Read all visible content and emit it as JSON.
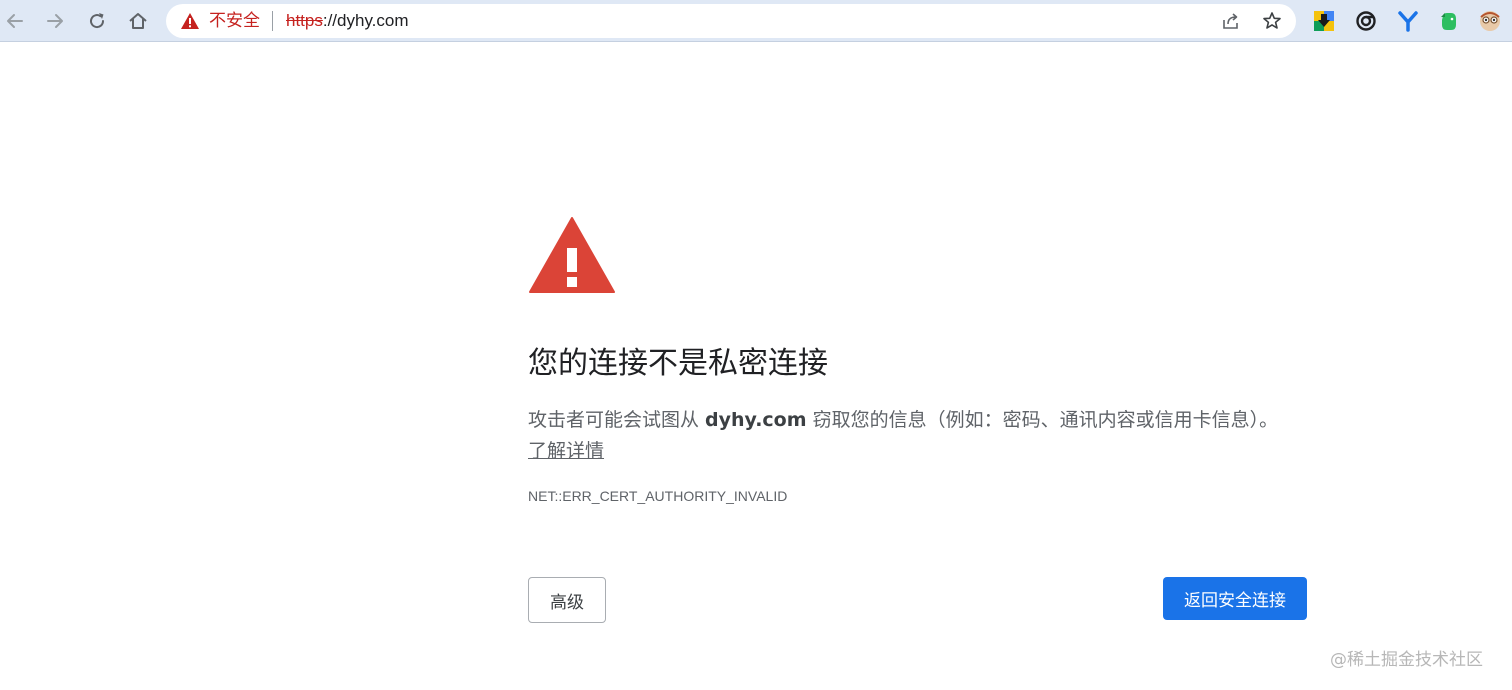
{
  "toolbar": {
    "security_label": "不安全",
    "url_scheme": "https",
    "url_rest": "://dyhy.com"
  },
  "icons": {
    "back": "back-arrow-icon",
    "forward": "forward-arrow-icon",
    "reload": "reload-icon",
    "home": "home-icon",
    "warning": "warning-triangle-icon",
    "share": "share-icon",
    "bookmark": "star-icon",
    "extensions": [
      "download-extension-icon",
      "spiral-extension-icon",
      "y-extension-icon",
      "evernote-icon",
      "avatar-extension-icon"
    ]
  },
  "page": {
    "heading": "您的连接不是私密连接",
    "desc_before": "攻击者可能会试图从 ",
    "desc_host": "dyhy.com",
    "desc_after": " 窃取您的信息（例如：密码、通讯内容或信用卡信息）。",
    "learn_more": "了解详情",
    "error_code": "NET::ERR_CERT_AUTHORITY_INVALID",
    "advanced_button": "高级",
    "back_button": "返回安全连接"
  },
  "watermark": "@稀土掘金技术社区",
  "colors": {
    "danger": "#c5221f",
    "warning_icon": "#db4437",
    "primary_button": "#1a73e8",
    "toolbar_bg": "#dfe8f5"
  }
}
